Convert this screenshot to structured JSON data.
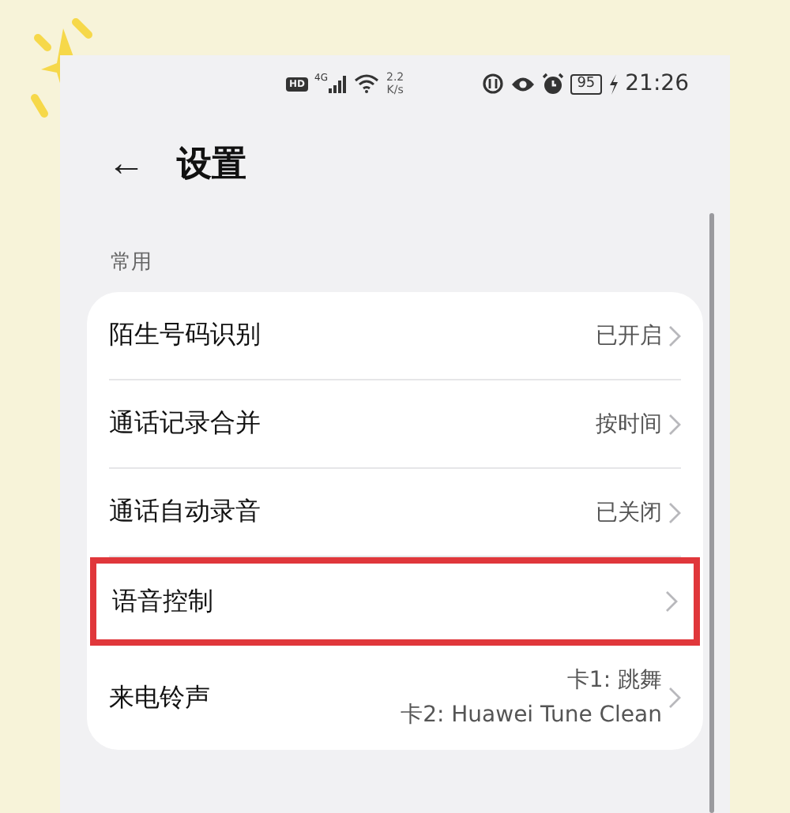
{
  "status_bar": {
    "hd": "HD",
    "network": "4G",
    "speed_value": "2.2",
    "speed_unit": "K/s",
    "battery": "95",
    "time": "21:26"
  },
  "header": {
    "back": "←",
    "title": "设置"
  },
  "section": {
    "label": "常用"
  },
  "rows": [
    {
      "label": "陌生号码识别",
      "value_lines": [
        "已开启"
      ],
      "highlighted": false
    },
    {
      "label": "通话记录合并",
      "value_lines": [
        "按时间"
      ],
      "highlighted": false
    },
    {
      "label": "通话自动录音",
      "value_lines": [
        "已关闭"
      ],
      "highlighted": false
    },
    {
      "label": "语音控制",
      "value_lines": [],
      "highlighted": true
    },
    {
      "label": "来电铃声",
      "value_lines": [
        "卡1: 跳舞",
        "卡2: Huawei Tune Clean"
      ],
      "highlighted": false
    }
  ]
}
